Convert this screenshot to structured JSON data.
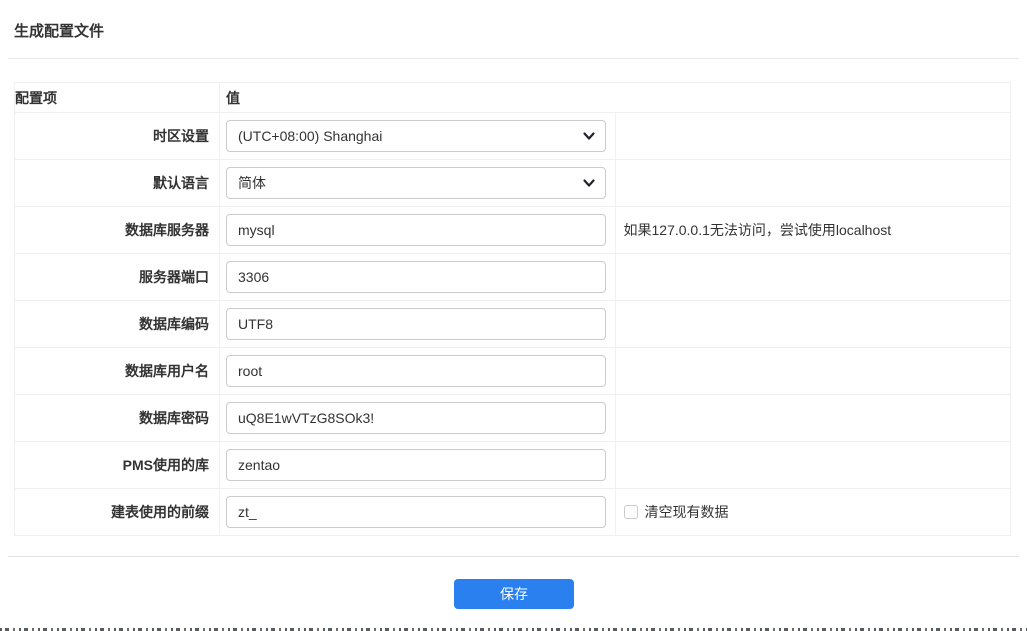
{
  "page": {
    "title": "生成配置文件"
  },
  "table": {
    "headers": {
      "item": "配置项",
      "value": "值"
    },
    "rows": [
      {
        "label": "时区设置",
        "control": "select",
        "value": "(UTC+08:00) Shanghai",
        "hint": ""
      },
      {
        "label": "默认语言",
        "control": "select",
        "value": "简体",
        "hint": ""
      },
      {
        "label": "数据库服务器",
        "control": "input",
        "value": "mysql",
        "hint": "如果127.0.0.1无法访问，尝试使用localhost"
      },
      {
        "label": "服务器端口",
        "control": "input",
        "value": "3306",
        "hint": ""
      },
      {
        "label": "数据库编码",
        "control": "input",
        "value": "UTF8",
        "hint": ""
      },
      {
        "label": "数据库用户名",
        "control": "input",
        "value": "root",
        "hint": ""
      },
      {
        "label": "数据库密码",
        "control": "input",
        "value": "uQ8E1wVTzG8SOk3!",
        "hint": ""
      },
      {
        "label": "PMS使用的库",
        "control": "input",
        "value": "zentao",
        "hint": ""
      },
      {
        "label": "建表使用的前缀",
        "control": "input",
        "value": "zt_",
        "hint": "",
        "checkbox_label": "清空现有数据",
        "checkbox_checked": false
      }
    ]
  },
  "actions": {
    "save_label": "保存"
  },
  "icons": {
    "select_chevron": "chevron-down-icon"
  },
  "colors": {
    "primary_button": "#2b80f0",
    "table_border": "#f0f0f0",
    "input_border": "#cbcbcb",
    "text": "#333333"
  }
}
